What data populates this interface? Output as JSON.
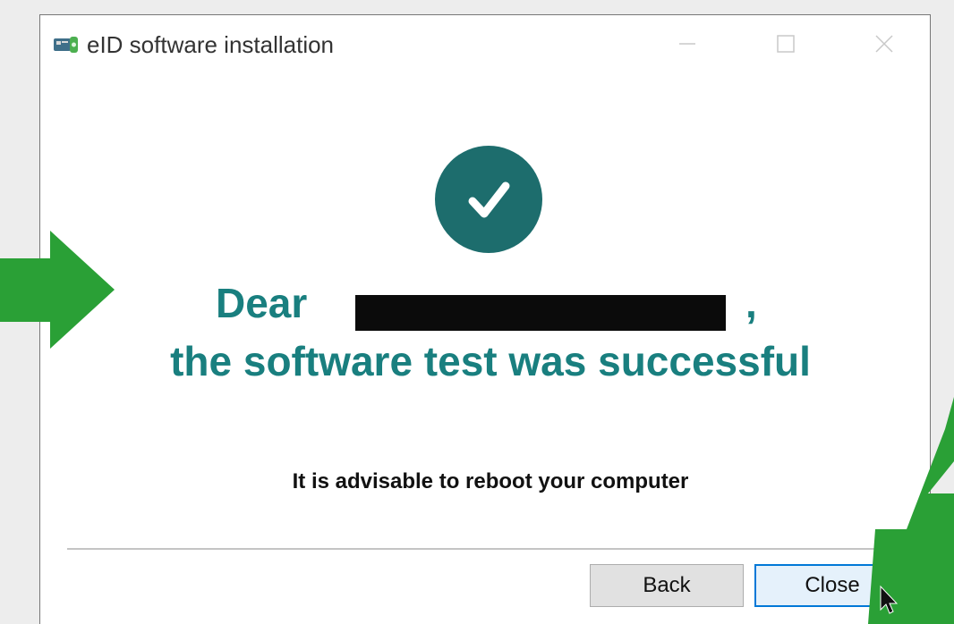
{
  "window": {
    "title": "eID software installation",
    "icon": "eid-card-reader-icon"
  },
  "titlebar_buttons": {
    "minimize_icon": "minimize-icon",
    "maximize_icon": "maximize-icon",
    "close_icon": "close-icon"
  },
  "status": {
    "icon": "checkmark-icon",
    "greeting_prefix": "Dear",
    "greeting_suffix": ",",
    "headline": "the software test was successful",
    "advice": "It is advisable to reboot your computer"
  },
  "buttons": {
    "back_label": "Back",
    "close_label": "Close"
  },
  "annotations": {
    "arrow_color": "#2aa036",
    "left_arrow_icon": "green-arrow-right-icon",
    "right_arrow_icon": "green-arrow-down-left-icon"
  },
  "colors": {
    "accent": "#197f7f",
    "check_circle": "#1d6d6d",
    "redaction": "#0b0b0b",
    "close_button_border": "#0078d7"
  },
  "cursor": {
    "icon": "mouse-pointer-icon"
  }
}
